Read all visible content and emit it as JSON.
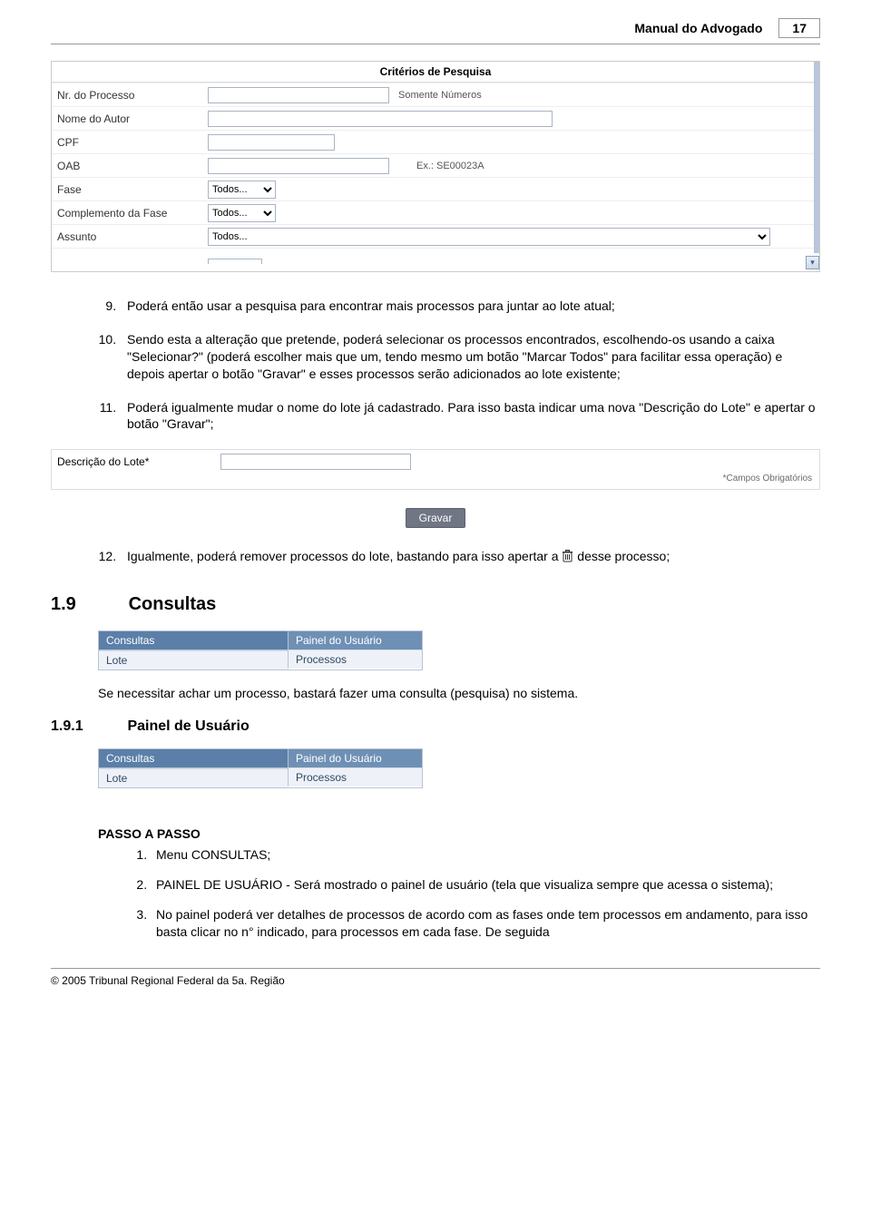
{
  "header": {
    "title": "Manual do Advogado",
    "page_number": "17"
  },
  "search_form": {
    "title": "Critérios de Pesquisa",
    "rows": {
      "nr_processo": {
        "label": "Nr. do Processo",
        "hint": "Somente Números"
      },
      "nome_autor": {
        "label": "Nome do Autor"
      },
      "cpf": {
        "label": "CPF"
      },
      "oab": {
        "label": "OAB",
        "hint": "Ex.: SE00023A"
      },
      "fase": {
        "label": "Fase",
        "value": "Todos..."
      },
      "compl_fase": {
        "label": "Complemento da Fase",
        "value": "Todos..."
      },
      "assunto": {
        "label": "Assunto",
        "value": "Todos..."
      }
    }
  },
  "list_items": {
    "i9": "Poderá então usar a pesquisa para encontrar mais processos para juntar ao lote atual;",
    "i10": "Sendo esta a alteração que pretende, poderá selecionar os processos encontrados, escolhendo-os usando a caixa \"Selecionar?\" (poderá escolher mais que um, tendo mesmo um botão \"Marcar Todos\" para facilitar essa operação) e depois apertar o botão \"Gravar\" e esses processos serão adicionados ao lote existente;",
    "i11": "Poderá igualmente mudar o nome do lote já cadastrado. Para isso basta indicar uma nova \"Descrição do Lote\" e apertar o botão \"Gravar\";",
    "i12_a": "Igualmente, poderá remover processos do lote, bastando para isso apertar a ",
    "i12_b": " desse processo;"
  },
  "desc_lote": {
    "label": "Descrição do Lote*",
    "oblig": "*Campos Obrigatórios",
    "button": "Gravar"
  },
  "section_19": {
    "number": "1.9",
    "title": "Consultas"
  },
  "para_19": "Se necessitar achar um processo, bastará fazer uma consulta (pesquisa) no sistema.",
  "section_191": {
    "number": "1.9.1",
    "title": "Painel de Usuário"
  },
  "menu": {
    "left_header": "Consultas",
    "left_item": "Lote",
    "right_header": "Painel do Usuário",
    "right_item": "Processos"
  },
  "passo_title": "PASSO A PASSO",
  "passo": {
    "p1": "Menu CONSULTAS;",
    "p2": "PAINEL DE USUÁRIO - Será mostrado o painel de usuário (tela que visualiza sempre que acessa o sistema);",
    "p3": "No painel poderá ver detalhes de processos de acordo com as fases onde tem processos em andamento, para isso basta clicar no n° indicado, para processos em cada fase. De seguida"
  },
  "footer": "© 2005 Tribunal Regional Federal da 5a. Região"
}
